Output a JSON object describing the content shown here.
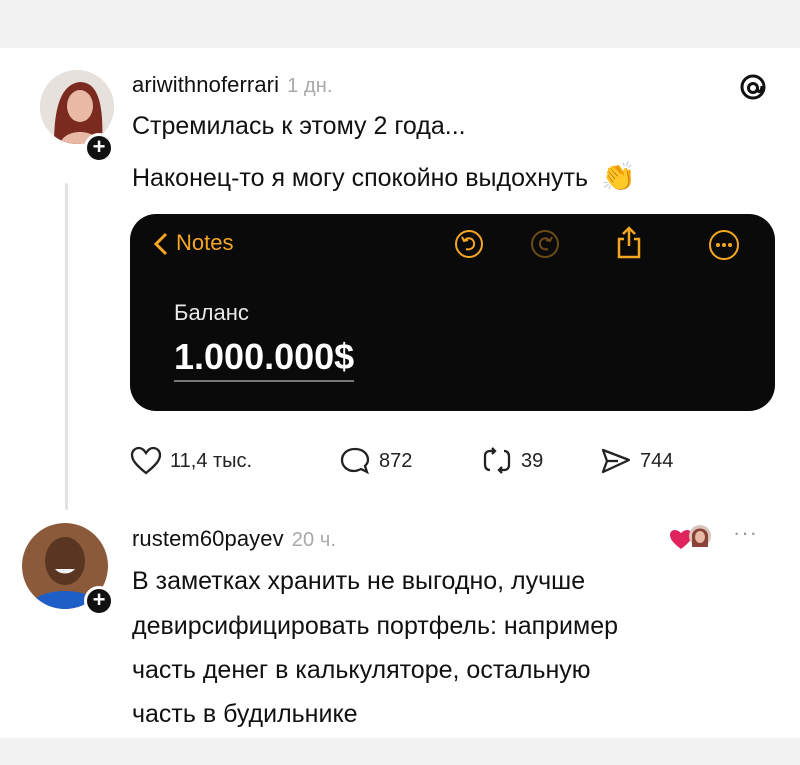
{
  "post": {
    "username": "ariwithnoferrari",
    "time": "1 дн.",
    "lines": [
      "Стремилась к этому 2 года...",
      "Наконец-то я могу спокойно выдохнуть"
    ],
    "emoji": "👏",
    "notes": {
      "back_label": "Notes",
      "label": "Баланс",
      "value": "1.000.000$"
    },
    "stats": {
      "likes": "11,4 тыс.",
      "comments": "872",
      "reposts": "39",
      "shares": "744"
    }
  },
  "reply": {
    "username": "rustem60payev",
    "time": "20 ч.",
    "lines": [
      "В заметках хранить не выгодно, лучше",
      "девирсифицировать портфель: например",
      "часть денег в калькуляторе, остальную",
      "часть в будильнике"
    ],
    "more": "···"
  },
  "colors": {
    "accent": "#f5a623",
    "card_bg": "#0a0a0a",
    "heart": "#e0245e"
  }
}
